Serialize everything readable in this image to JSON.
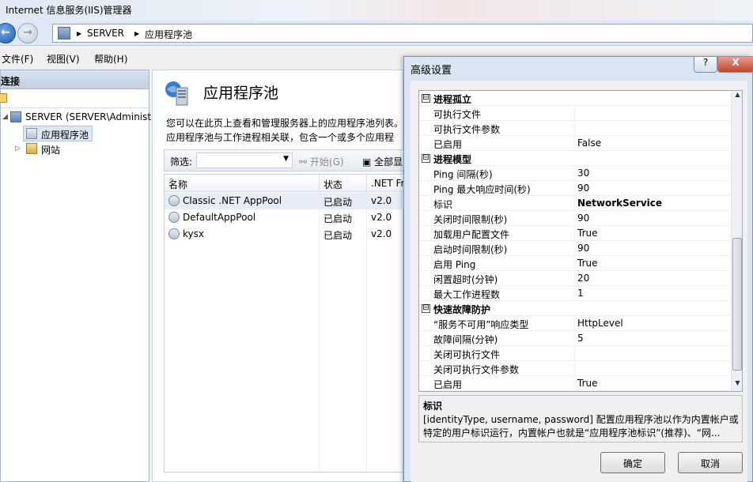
{
  "window": {
    "title": "Internet 信息服务(IIS)管理器"
  },
  "address": {
    "crumbs": [
      "SERVER",
      "应用程序池"
    ]
  },
  "menu": [
    "文件(F)",
    "视图(V)",
    "帮助(H)"
  ],
  "connections": {
    "header": "连接",
    "tree": [
      {
        "label": "SERVER (SERVER\\Administ",
        "expander": "◢"
      },
      {
        "label": "应用程序池"
      },
      {
        "label": "网站",
        "expander": "▷"
      }
    ]
  },
  "main": {
    "title": "应用程序池",
    "description": "您可以在此页上查看和管理服务器上的应用程序池列表。应用程序池与工作进程相关联，包含一个或多个应用程序，并提供不同应用程序之间的隔离。",
    "filter_label": "筛选:",
    "start_label": "开始(G)",
    "show_all_label": "全部显",
    "columns": [
      "名称",
      "状态",
      ".NET Fr"
    ],
    "rows": [
      {
        "name": "Classic .NET AppPool",
        "status": "已启动",
        "net": "v2.0"
      },
      {
        "name": "DefaultAppPool",
        "status": "已启动",
        "net": "v2.0"
      },
      {
        "name": "kysx",
        "status": "已启动",
        "net": "v2.0"
      }
    ]
  },
  "dialog": {
    "title": "高级设置",
    "help_label": "?",
    "close_label": "X",
    "properties": [
      {
        "type": "cat",
        "name": "进程孤立",
        "toggle": "⊟"
      },
      {
        "name": "可执行文件",
        "value": ""
      },
      {
        "name": "可执行文件参数",
        "value": ""
      },
      {
        "name": "已启用",
        "value": "False"
      },
      {
        "type": "cat",
        "name": "进程模型",
        "toggle": "⊟"
      },
      {
        "name": "Ping 间隔(秒)",
        "value": "30"
      },
      {
        "name": "Ping 最大响应时间(秒)",
        "value": "90"
      },
      {
        "name": "标识",
        "value": "NetworkService",
        "bold": true
      },
      {
        "name": "关闭时间限制(秒)",
        "value": "90"
      },
      {
        "name": "加载用户配置文件",
        "value": "True"
      },
      {
        "name": "启动时间限制(秒)",
        "value": "90"
      },
      {
        "name": "启用 Ping",
        "value": "True"
      },
      {
        "name": "闲置超时(分钟)",
        "value": "20"
      },
      {
        "name": "最大工作进程数",
        "value": "1"
      },
      {
        "type": "cat",
        "name": "快速故障防护",
        "toggle": "⊟"
      },
      {
        "name": "“服务不可用”响应类型",
        "value": "HttpLevel"
      },
      {
        "name": "故障间隔(分钟)",
        "value": "5"
      },
      {
        "name": "关闭可执行文件",
        "value": ""
      },
      {
        "name": "关闭可执行文件参数",
        "value": ""
      },
      {
        "name": "已启用",
        "value": "True"
      }
    ],
    "description_title": "标识",
    "description_text": "[identityType, username, password] 配置应用程序池以作为内置帐户或特定的用户标识运行，内置帐户也就是“应用程序池标识”(推荐)、“网...",
    "ok_label": "确定",
    "cancel_label": "取消"
  }
}
